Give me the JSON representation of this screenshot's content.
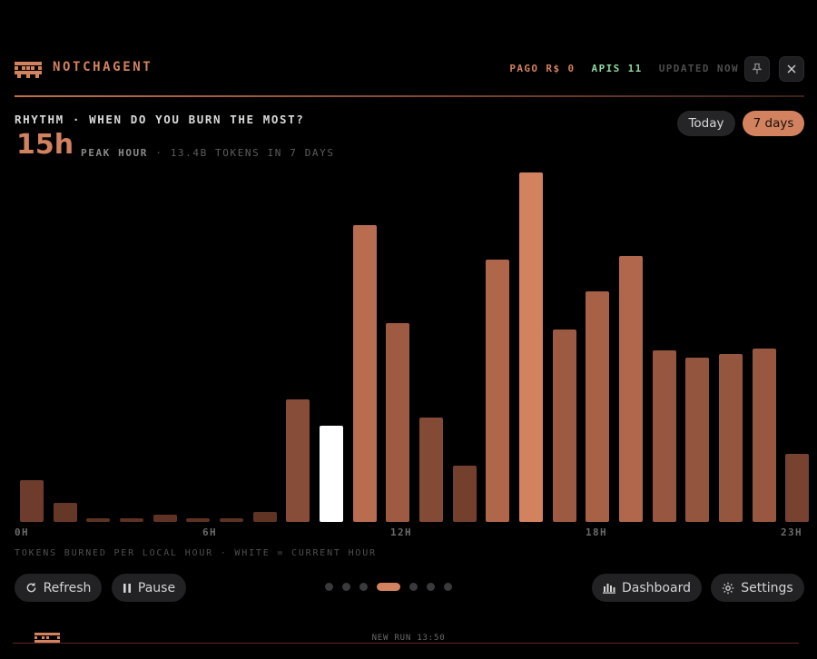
{
  "header": {
    "brand": "NOTCHAGENT",
    "status_pago": "PAGO R$ 0",
    "status_apis": "APIS 11",
    "status_updated": "UPDATED NOW",
    "pin_icon": "pin-icon",
    "close_icon": "close-icon"
  },
  "title": "RHYTHM · WHEN DO YOU BURN THE MOST?",
  "peak": {
    "value": "15h",
    "label": "PEAK HOUR",
    "sub": "· 13.4B TOKENS IN 7 DAYS"
  },
  "range": {
    "today": "Today",
    "seven_days": "7 days",
    "selected": "7 days"
  },
  "chart_data": {
    "type": "bar",
    "categories": [
      "0",
      "1",
      "2",
      "3",
      "4",
      "5",
      "6",
      "7",
      "8",
      "9",
      "10",
      "11",
      "12",
      "13",
      "14",
      "15",
      "16",
      "17",
      "18",
      "19",
      "20",
      "21",
      "22",
      "23"
    ],
    "values": [
      12,
      5.5,
      1,
      1,
      2,
      1,
      1,
      2.8,
      35,
      27.5,
      85,
      57,
      30,
      16,
      75,
      100,
      55,
      66,
      76,
      49,
      47,
      48,
      49.5,
      19.5
    ],
    "current_hour": 9,
    "peak_hour": 15,
    "x_tick_labels": [
      "0H",
      "6H",
      "12H",
      "18H",
      "23H"
    ],
    "caption": "TOKENS BURNED PER LOCAL HOUR · WHITE = CURRENT HOUR",
    "colors": {
      "peak": "#d2825f",
      "current": "#ffffff",
      "low": "#5a3022",
      "high": "#c57456"
    },
    "grid": false,
    "legend": "none"
  },
  "buttons": {
    "refresh": "Refresh",
    "pause": "Pause",
    "dashboard": "Dashboard",
    "settings": "Settings"
  },
  "pager": {
    "count": 7,
    "active": 3
  },
  "footer": {
    "text": "NEW RUN 13:50"
  }
}
